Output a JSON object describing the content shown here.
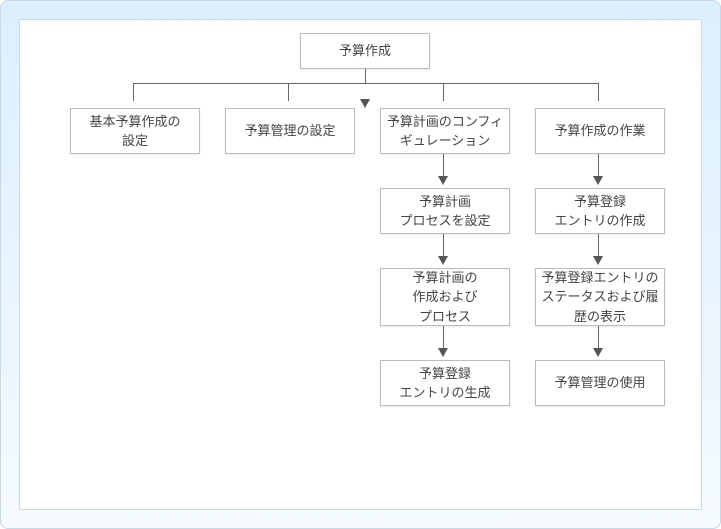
{
  "root": {
    "title": "予算作成"
  },
  "level1": {
    "n1": "基本予算作成の\n設定",
    "n2": "予算管理の設定",
    "n3": "予算計画のコンフィギュレーション",
    "n4": "予算作成の作業"
  },
  "col3": {
    "n1": "予算計画\nプロセスを設定",
    "n2": "予算計画の\n作成および\nプロセス",
    "n3": "予算登録\nエントリの生成"
  },
  "col4": {
    "n1": "予算登録\nエントリの作成",
    "n2": "予算登録エントリのステータスおよび履歴の表示",
    "n3": "予算管理の使用"
  }
}
